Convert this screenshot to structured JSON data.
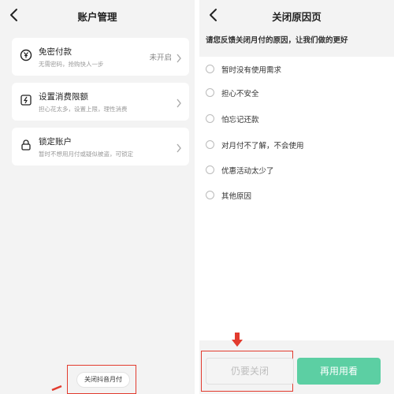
{
  "left_screen": {
    "title": "账户管理",
    "cards": [
      {
        "icon": "yen-coin-icon",
        "title": "免密付款",
        "subtitle": "无需密码，抢购快人一步",
        "status": "未开启"
      },
      {
        "icon": "lightning-icon",
        "title": "设置消费限额",
        "subtitle": "担心花太多，设置上限，理性消费",
        "status": ""
      },
      {
        "icon": "lock-icon",
        "title": "锁定账户",
        "subtitle": "暂时不想用月付或疑似被盗，可锁定",
        "status": ""
      }
    ],
    "close_link": "关闭抖音月付"
  },
  "right_screen": {
    "title": "关闭原因页",
    "prompt": "请您反馈关闭月付的原因，让我们做的更好",
    "options": [
      "暂时没有使用需求",
      "担心不安全",
      "怕忘记还款",
      "对月付不了解，不会使用",
      "优惠活动太少了",
      "其他原因"
    ],
    "still_close_button": "仍要关闭",
    "use_again_button": "再用用看"
  },
  "colors": {
    "accent_green": "#5ccfa3",
    "highlight_red": "#e23b2e",
    "background": "#f3f3f3"
  }
}
